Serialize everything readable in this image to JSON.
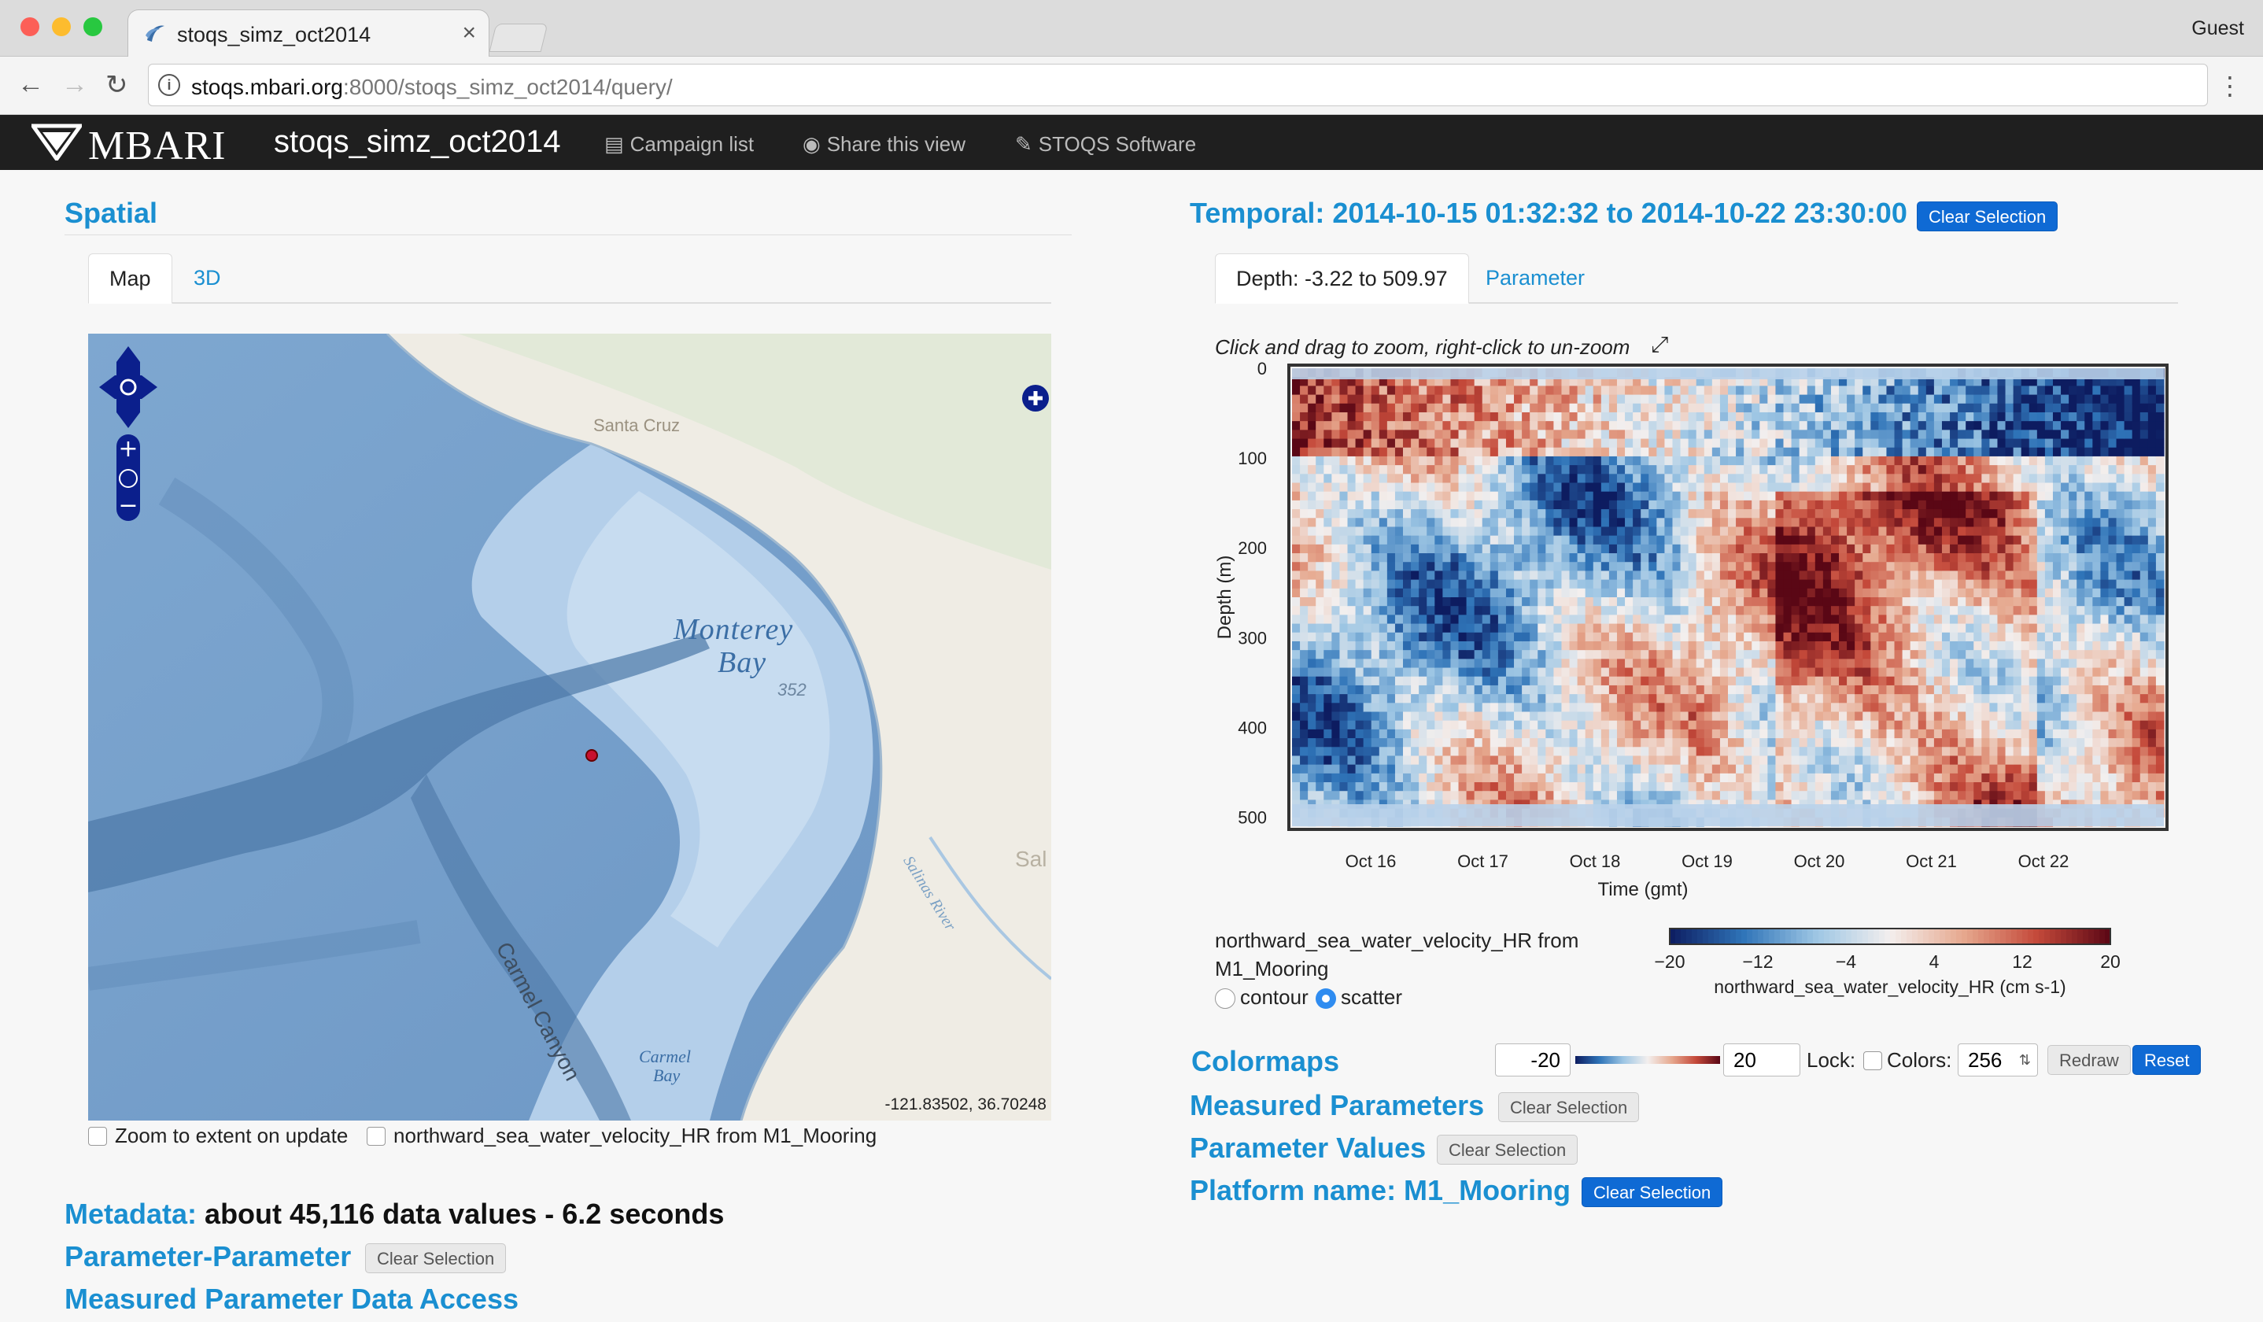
{
  "browser": {
    "tab_title": "stoqs_simz_oct2014",
    "tab_close": "×",
    "profile": "Guest",
    "url_host": "stoqs.mbari.org",
    "url_rest": ":8000/stoqs_simz_oct2014/query/"
  },
  "navbar": {
    "logo": "MBARI",
    "brand": "stoqs_simz_oct2014",
    "links": [
      "Campaign list",
      "Share this view",
      "STOQS Software"
    ]
  },
  "spatial": {
    "title": "Spatial",
    "tabs": [
      "Map",
      "3D"
    ],
    "active_tab": "Map",
    "map_labels": {
      "santa_cruz": "Santa Cruz",
      "monterey": "Monterey",
      "bay": "Bay",
      "depth_352": "352",
      "salinas_river": "Salinas River",
      "sal": "Sal",
      "carmel_canyon": "Carmel Canyon",
      "carmel": "Carmel",
      "carmel_bay": "Bay"
    },
    "map_coords": "-121.83502, 36.70248",
    "checkbox_zoom": "Zoom to extent on update",
    "checkbox_param": "northward_sea_water_velocity_HR from M1_Mooring"
  },
  "metadata": {
    "title_blue": "Metadata:",
    "title_black": "about 45,116 data values - 6.2 seconds"
  },
  "param_param": {
    "title": "Parameter-Parameter",
    "clear": "Clear Selection"
  },
  "measured_access": {
    "title": "Measured Parameter Data Access"
  },
  "temporal": {
    "title": "Temporal: 2014-10-15 01:32:32 to 2014-10-22 23:30:00",
    "clear": "Clear Selection",
    "tabs": [
      "Depth: -3.22 to 509.97",
      "Parameter"
    ],
    "hint": "Click and drag to zoom, right-click to un-zoom",
    "plot_caption_line1": "northward_sea_water_velocity_HR from",
    "plot_caption_line2": "M1_Mooring",
    "radio_contour": "contour",
    "radio_scatter": "scatter",
    "selected_plot_type": "scatter"
  },
  "chart_data": {
    "type": "heatmap",
    "xlabel": "Time (gmt)",
    "ylabel": "Depth (m)",
    "x_tick_labels": [
      "Oct 16",
      "Oct 17",
      "Oct 18",
      "Oct 19",
      "Oct 20",
      "Oct 21",
      "Oct 22"
    ],
    "y_tick_labels": [
      "0",
      "100",
      "200",
      "300",
      "400",
      "500"
    ],
    "y_ticks": [
      0,
      100,
      200,
      300,
      400,
      500
    ],
    "ylim": [
      510,
      0
    ],
    "colorbar": {
      "label": "northward_sea_water_velocity_HR (cm s-1)",
      "tick_labels": [
        "−20",
        "−12",
        "−4",
        "4",
        "12",
        "20"
      ],
      "range": [
        -20,
        20
      ]
    },
    "colors": {
      "dark_blue": "#0d1c60",
      "blue": "#2f74b8",
      "light_blue": "#9ec6e4",
      "white": "#f3efee",
      "light_red": "#e6a88e",
      "red": "#c4493a",
      "dark_red": "#5a0715"
    }
  },
  "colormaps": {
    "title": "Colormaps",
    "min": "-20",
    "max": "20",
    "lock_label": "Lock:",
    "colors_label": "Colors:",
    "colors_value": "256",
    "redraw": "Redraw",
    "reset": "Reset"
  },
  "measured_params": {
    "title": "Measured Parameters",
    "clear": "Clear Selection"
  },
  "param_values": {
    "title": "Parameter Values",
    "clear": "Clear Selection"
  },
  "platform": {
    "title": "Platform name: M1_Mooring",
    "clear": "Clear Selection"
  }
}
